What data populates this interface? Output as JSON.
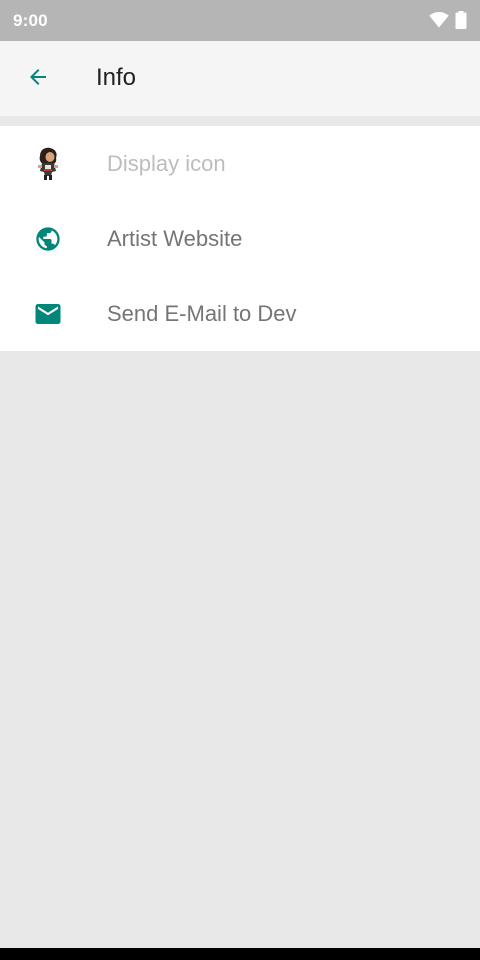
{
  "status_bar": {
    "time": "9:00",
    "icons": [
      "wifi-icon",
      "battery-icon"
    ]
  },
  "app_bar": {
    "back_icon": "arrow-left-icon",
    "title": "Info"
  },
  "list": {
    "items": [
      {
        "label": "Display icon",
        "icon": "character-avatar-icon",
        "enabled": false
      },
      {
        "label": "Artist Website",
        "icon": "globe-icon",
        "enabled": true
      },
      {
        "label": "Send E-Mail to Dev",
        "icon": "email-icon",
        "enabled": true
      }
    ]
  },
  "colors": {
    "accent": "#00877a",
    "status_bar": "#b5b5b5",
    "app_bar": "#f5f5f5",
    "background": "#e8e8e8",
    "text_primary": "#212121",
    "text_secondary": "#757575",
    "text_disabled": "#bdbdbd"
  }
}
